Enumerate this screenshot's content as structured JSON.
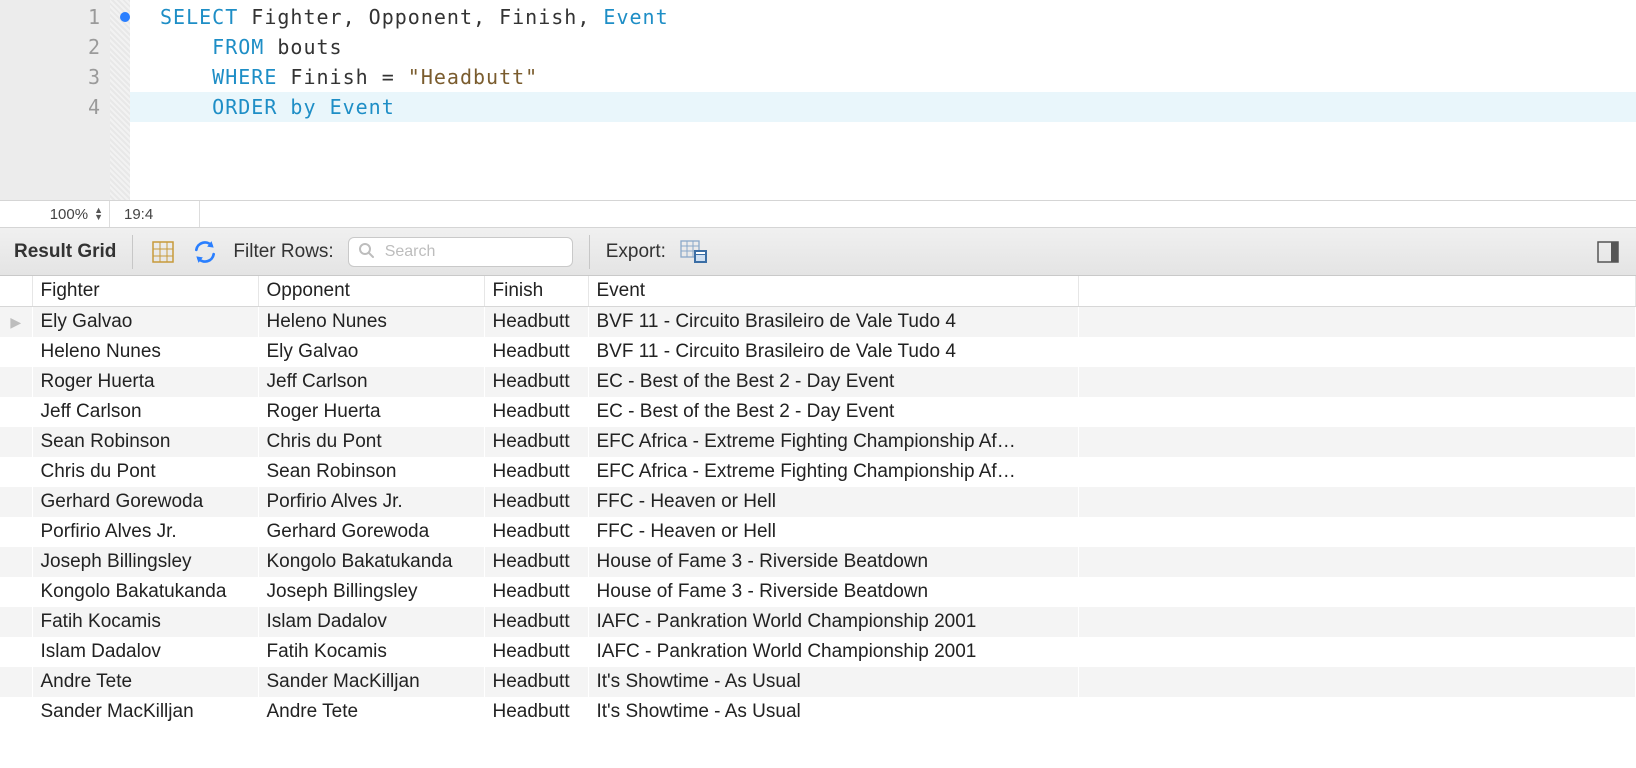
{
  "editor": {
    "lines": [
      {
        "n": "1",
        "dot": true
      },
      {
        "n": "2",
        "dot": false
      },
      {
        "n": "3",
        "dot": false
      },
      {
        "n": "4",
        "dot": false
      }
    ],
    "code": {
      "select_kw": "SELECT",
      "select_cols": " Fighter, Opponent, Finish, ",
      "select_last": "Event",
      "from_kw": "FROM",
      "from_tbl": " bouts",
      "where_kw": "WHERE",
      "where_col": " Finish ",
      "where_eq": "=",
      "where_val": " \"Headbutt\"",
      "order_kw": "ORDER",
      "order_by": " by ",
      "order_col": "Event"
    }
  },
  "status": {
    "zoom": "100%",
    "cursor": "19:4"
  },
  "toolbar": {
    "result_grid": "Result Grid",
    "filter_label": "Filter Rows:",
    "search_placeholder": "Search",
    "export_label": "Export:"
  },
  "grid": {
    "columns": [
      "Fighter",
      "Opponent",
      "Finish",
      "Event"
    ],
    "rows": [
      {
        "fighter": "Ely Galvao",
        "opponent": "Heleno Nunes",
        "finish": "Headbutt",
        "event": "BVF 11 - Circuito Brasileiro de Vale Tudo 4",
        "current": true
      },
      {
        "fighter": "Heleno Nunes",
        "opponent": "Ely Galvao",
        "finish": "Headbutt",
        "event": "BVF 11 - Circuito Brasileiro de Vale Tudo 4"
      },
      {
        "fighter": "Roger Huerta",
        "opponent": "Jeff Carlson",
        "finish": "Headbutt",
        "event": "EC - Best of the Best 2 - Day Event"
      },
      {
        "fighter": "Jeff Carlson",
        "opponent": "Roger Huerta",
        "finish": "Headbutt",
        "event": "EC - Best of the Best 2 - Day Event"
      },
      {
        "fighter": "Sean Robinson",
        "opponent": "Chris du Pont",
        "finish": "Headbutt",
        "event": "EFC Africa - Extreme Fighting Championship Af…"
      },
      {
        "fighter": "Chris du Pont",
        "opponent": "Sean Robinson",
        "finish": "Headbutt",
        "event": "EFC Africa - Extreme Fighting Championship Af…"
      },
      {
        "fighter": "Gerhard Gorewoda",
        "opponent": "Porfirio Alves Jr.",
        "finish": "Headbutt",
        "event": "FFC - Heaven or Hell"
      },
      {
        "fighter": "Porfirio Alves Jr.",
        "opponent": "Gerhard Gorewoda",
        "finish": "Headbutt",
        "event": "FFC - Heaven or Hell"
      },
      {
        "fighter": "Joseph Billingsley",
        "opponent": "Kongolo Bakatukanda",
        "finish": "Headbutt",
        "event": "House of Fame 3 - Riverside Beatdown"
      },
      {
        "fighter": "Kongolo Bakatukanda",
        "opponent": "Joseph Billingsley",
        "finish": "Headbutt",
        "event": "House of Fame 3 - Riverside Beatdown"
      },
      {
        "fighter": "Fatih Kocamis",
        "opponent": "Islam Dadalov",
        "finish": "Headbutt",
        "event": "IAFC - Pankration World Championship 2001"
      },
      {
        "fighter": "Islam Dadalov",
        "opponent": "Fatih Kocamis",
        "finish": "Headbutt",
        "event": "IAFC - Pankration World Championship 2001"
      },
      {
        "fighter": "Andre Tete",
        "opponent": "Sander MacKilljan",
        "finish": "Headbutt",
        "event": "It's Showtime - As Usual"
      },
      {
        "fighter": "Sander MacKilljan",
        "opponent": "Andre Tete",
        "finish": "Headbutt",
        "event": "It's Showtime - As Usual"
      }
    ]
  }
}
